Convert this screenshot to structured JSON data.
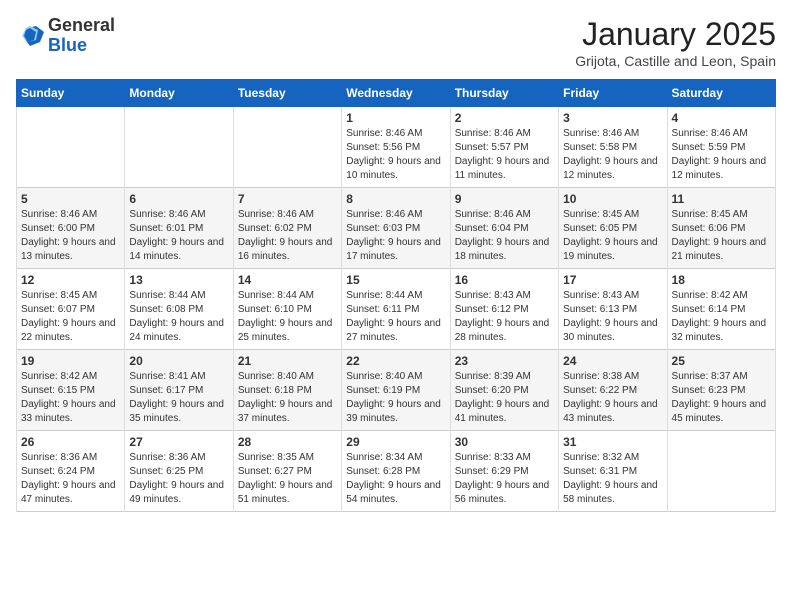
{
  "header": {
    "logo_general": "General",
    "logo_blue": "Blue",
    "month_year": "January 2025",
    "location": "Grijota, Castille and Leon, Spain"
  },
  "days_of_week": [
    "Sunday",
    "Monday",
    "Tuesday",
    "Wednesday",
    "Thursday",
    "Friday",
    "Saturday"
  ],
  "weeks": [
    [
      {
        "day": "",
        "info": ""
      },
      {
        "day": "",
        "info": ""
      },
      {
        "day": "",
        "info": ""
      },
      {
        "day": "1",
        "info": "Sunrise: 8:46 AM\nSunset: 5:56 PM\nDaylight: 9 hours\nand 10 minutes."
      },
      {
        "day": "2",
        "info": "Sunrise: 8:46 AM\nSunset: 5:57 PM\nDaylight: 9 hours\nand 11 minutes."
      },
      {
        "day": "3",
        "info": "Sunrise: 8:46 AM\nSunset: 5:58 PM\nDaylight: 9 hours\nand 12 minutes."
      },
      {
        "day": "4",
        "info": "Sunrise: 8:46 AM\nSunset: 5:59 PM\nDaylight: 9 hours\nand 12 minutes."
      }
    ],
    [
      {
        "day": "5",
        "info": "Sunrise: 8:46 AM\nSunset: 6:00 PM\nDaylight: 9 hours\nand 13 minutes."
      },
      {
        "day": "6",
        "info": "Sunrise: 8:46 AM\nSunset: 6:01 PM\nDaylight: 9 hours\nand 14 minutes."
      },
      {
        "day": "7",
        "info": "Sunrise: 8:46 AM\nSunset: 6:02 PM\nDaylight: 9 hours\nand 16 minutes."
      },
      {
        "day": "8",
        "info": "Sunrise: 8:46 AM\nSunset: 6:03 PM\nDaylight: 9 hours\nand 17 minutes."
      },
      {
        "day": "9",
        "info": "Sunrise: 8:46 AM\nSunset: 6:04 PM\nDaylight: 9 hours\nand 18 minutes."
      },
      {
        "day": "10",
        "info": "Sunrise: 8:45 AM\nSunset: 6:05 PM\nDaylight: 9 hours\nand 19 minutes."
      },
      {
        "day": "11",
        "info": "Sunrise: 8:45 AM\nSunset: 6:06 PM\nDaylight: 9 hours\nand 21 minutes."
      }
    ],
    [
      {
        "day": "12",
        "info": "Sunrise: 8:45 AM\nSunset: 6:07 PM\nDaylight: 9 hours\nand 22 minutes."
      },
      {
        "day": "13",
        "info": "Sunrise: 8:44 AM\nSunset: 6:08 PM\nDaylight: 9 hours\nand 24 minutes."
      },
      {
        "day": "14",
        "info": "Sunrise: 8:44 AM\nSunset: 6:10 PM\nDaylight: 9 hours\nand 25 minutes."
      },
      {
        "day": "15",
        "info": "Sunrise: 8:44 AM\nSunset: 6:11 PM\nDaylight: 9 hours\nand 27 minutes."
      },
      {
        "day": "16",
        "info": "Sunrise: 8:43 AM\nSunset: 6:12 PM\nDaylight: 9 hours\nand 28 minutes."
      },
      {
        "day": "17",
        "info": "Sunrise: 8:43 AM\nSunset: 6:13 PM\nDaylight: 9 hours\nand 30 minutes."
      },
      {
        "day": "18",
        "info": "Sunrise: 8:42 AM\nSunset: 6:14 PM\nDaylight: 9 hours\nand 32 minutes."
      }
    ],
    [
      {
        "day": "19",
        "info": "Sunrise: 8:42 AM\nSunset: 6:15 PM\nDaylight: 9 hours\nand 33 minutes."
      },
      {
        "day": "20",
        "info": "Sunrise: 8:41 AM\nSunset: 6:17 PM\nDaylight: 9 hours\nand 35 minutes."
      },
      {
        "day": "21",
        "info": "Sunrise: 8:40 AM\nSunset: 6:18 PM\nDaylight: 9 hours\nand 37 minutes."
      },
      {
        "day": "22",
        "info": "Sunrise: 8:40 AM\nSunset: 6:19 PM\nDaylight: 9 hours\nand 39 minutes."
      },
      {
        "day": "23",
        "info": "Sunrise: 8:39 AM\nSunset: 6:20 PM\nDaylight: 9 hours\nand 41 minutes."
      },
      {
        "day": "24",
        "info": "Sunrise: 8:38 AM\nSunset: 6:22 PM\nDaylight: 9 hours\nand 43 minutes."
      },
      {
        "day": "25",
        "info": "Sunrise: 8:37 AM\nSunset: 6:23 PM\nDaylight: 9 hours\nand 45 minutes."
      }
    ],
    [
      {
        "day": "26",
        "info": "Sunrise: 8:36 AM\nSunset: 6:24 PM\nDaylight: 9 hours\nand 47 minutes."
      },
      {
        "day": "27",
        "info": "Sunrise: 8:36 AM\nSunset: 6:25 PM\nDaylight: 9 hours\nand 49 minutes."
      },
      {
        "day": "28",
        "info": "Sunrise: 8:35 AM\nSunset: 6:27 PM\nDaylight: 9 hours\nand 51 minutes."
      },
      {
        "day": "29",
        "info": "Sunrise: 8:34 AM\nSunset: 6:28 PM\nDaylight: 9 hours\nand 54 minutes."
      },
      {
        "day": "30",
        "info": "Sunrise: 8:33 AM\nSunset: 6:29 PM\nDaylight: 9 hours\nand 56 minutes."
      },
      {
        "day": "31",
        "info": "Sunrise: 8:32 AM\nSunset: 6:31 PM\nDaylight: 9 hours\nand 58 minutes."
      },
      {
        "day": "",
        "info": ""
      }
    ]
  ]
}
